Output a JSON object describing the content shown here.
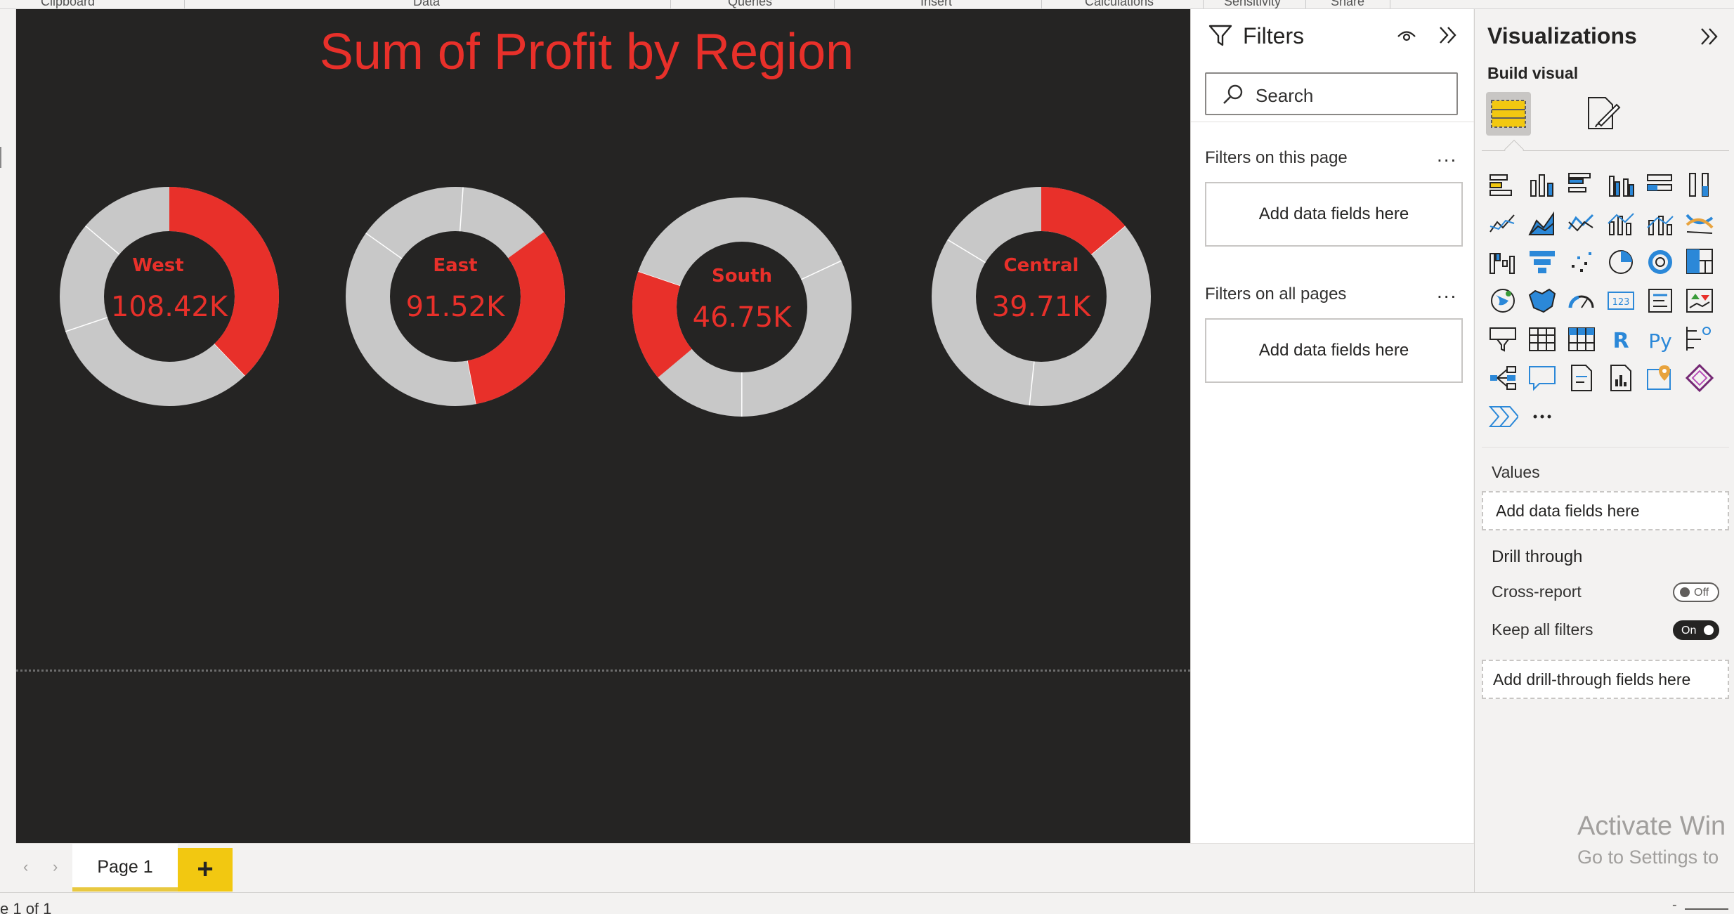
{
  "ribbon": {
    "groups": [
      "Clipboard",
      "Data",
      "Queries",
      "Insert",
      "Calculations",
      "Sensitivity",
      "Share"
    ]
  },
  "report": {
    "title": "Sum of Profit by Region"
  },
  "chart_data": {
    "type": "pie",
    "variant": "donut",
    "measure": "Sum of Profit",
    "categories": [
      "West",
      "East",
      "South",
      "Central"
    ],
    "values": [
      108.42,
      91.52,
      46.75,
      39.71
    ],
    "value_labels": [
      "108.42K",
      "91.52K",
      "46.75K",
      "39.71K"
    ],
    "units": "K",
    "highlight_color": "#e8302a",
    "rest_color": "#c8c8c8",
    "background": "#252423"
  },
  "filters": {
    "title": "Filters",
    "search_placeholder": "Search",
    "on_this_page": "Filters on this page",
    "on_all_pages": "Filters on all pages",
    "more": "...",
    "well_text": "Add data fields here"
  },
  "visualizations": {
    "title": "Visualizations",
    "build_visual": "Build visual",
    "more": "...",
    "values_label": "Values",
    "values_well": "Add data fields here",
    "drill_through": "Drill through",
    "cross_report": "Cross-report",
    "cross_report_state": "Off",
    "keep_all_filters": "Keep all filters",
    "keep_all_filters_state": "On",
    "drill_well": "Add drill-through fields here",
    "icons": [
      "stacked-bar-chart-icon",
      "stacked-column-chart-icon",
      "clustered-bar-chart-icon",
      "clustered-column-chart-icon",
      "100-stacked-bar-chart-icon",
      "100-stacked-column-chart-icon",
      "line-chart-icon",
      "area-chart-icon",
      "stacked-area-chart-icon",
      "line-and-stacked-column-chart-icon",
      "line-and-clustered-column-chart-icon",
      "ribbon-chart-icon",
      "waterfall-chart-icon",
      "funnel-chart-icon",
      "scatter-chart-icon",
      "pie-chart-icon",
      "donut-chart-icon",
      "treemap-icon",
      "map-icon",
      "filled-map-icon",
      "gauge-icon",
      "card-icon",
      "multi-row-card-icon",
      "kpi-icon",
      "slicer-icon",
      "table-icon",
      "matrix-icon",
      "r-script-visual-icon",
      "python-visual-icon",
      "key-influencers-icon",
      "decomposition-tree-icon",
      "qa-icon",
      "smart-narrative-icon",
      "paginated-report-icon",
      "azure-map-icon",
      "power-apps-icon",
      "power-automate-icon",
      "more-visuals-icon"
    ]
  },
  "watermark": {
    "title": "Activate Win",
    "subtitle": "Go to Settings to"
  },
  "pages": {
    "tab": "Page 1",
    "add": "+"
  },
  "status": {
    "text": "e 1 of 1",
    "zoom_minus": "-"
  }
}
